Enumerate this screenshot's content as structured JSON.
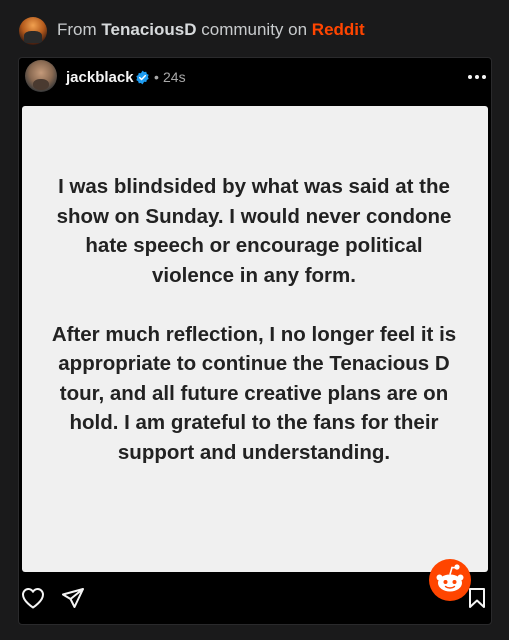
{
  "header": {
    "prefix": "From",
    "community": "TenaciousD",
    "middle": "community on",
    "brand": "Reddit"
  },
  "post": {
    "username": "jackblack",
    "separator": "•",
    "time": "24s",
    "story_paragraphs": [
      "I was blindsided by what was said at the show on Sunday. I would never condone hate speech or encourage political violence in any form.",
      "After much reflection, I no longer feel it is appropriate to continue the Tenacious D tour, and all future creative plans are on hold. I am grateful to the fans for their support and understanding."
    ]
  },
  "icons": {
    "verified": "verified-badge-icon",
    "more": "more-options-icon",
    "like": "heart-icon",
    "share": "send-icon",
    "save": "bookmark-icon",
    "reddit": "reddit-snoo-icon"
  },
  "colors": {
    "reddit_orange": "#ff4500",
    "verified_blue": "#1d9bf0",
    "story_background": "#f0f0f0"
  }
}
